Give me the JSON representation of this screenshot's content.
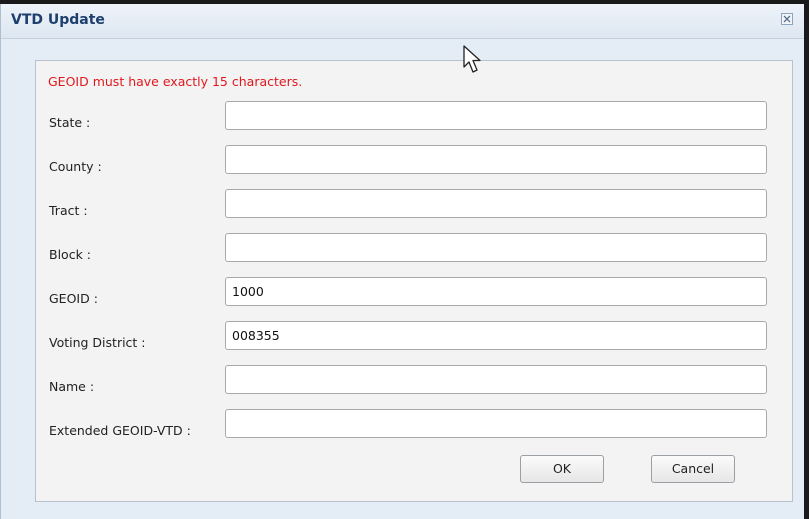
{
  "dialog": {
    "title": "VTD Update",
    "close_icon": "close-icon"
  },
  "form": {
    "error_message": "GEOID must have exactly 15 characters.",
    "error_color": "#e0181e",
    "fields": [
      {
        "label": "State :",
        "value": ""
      },
      {
        "label": "County :",
        "value": ""
      },
      {
        "label": "Tract :",
        "value": ""
      },
      {
        "label": "Block :",
        "value": ""
      },
      {
        "label": "GEOID :",
        "value": "1000"
      },
      {
        "label": "Voting District :",
        "value": "008355"
      },
      {
        "label": "Name :",
        "value": ""
      },
      {
        "label": "Extended GEOID-VTD :",
        "value": ""
      }
    ]
  },
  "buttons": {
    "ok_label": "OK",
    "cancel_label": "Cancel"
  },
  "cursor_icon": "mouse-pointer-icon"
}
